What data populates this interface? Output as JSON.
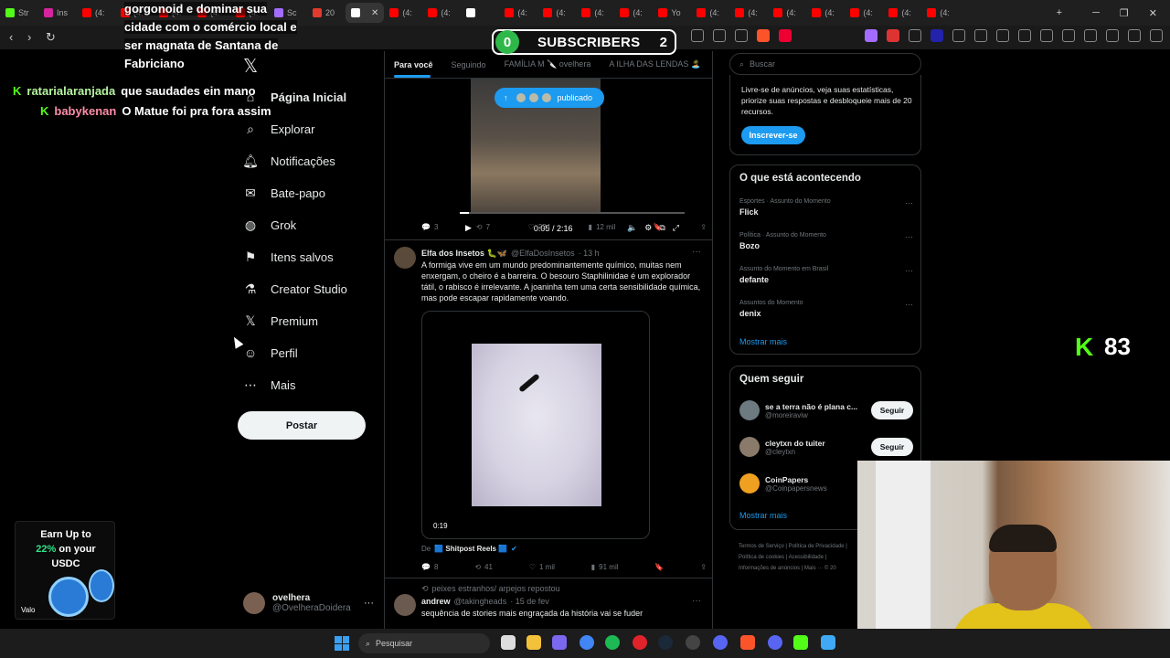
{
  "browser": {
    "tabs": [
      {
        "label": "Str",
        "color": "#53fc18"
      },
      {
        "label": "Ins",
        "color": "#d6249f"
      },
      {
        "label": "(4:",
        "color": "#ff0000"
      },
      {
        "label": "(4:",
        "color": "#ff0000"
      },
      {
        "label": "(4:",
        "color": "#ff0000"
      },
      {
        "label": "(4:",
        "color": "#ff0000"
      },
      {
        "label": "(4:",
        "color": "#ff0000"
      },
      {
        "label": "Sc",
        "color": "#a36cff"
      },
      {
        "label": "20",
        "color": "#e03b2e"
      },
      {
        "label": "",
        "color": "#ffffff",
        "active": true
      },
      {
        "label": "(4:",
        "color": "#ff0000"
      },
      {
        "label": "(4:",
        "color": "#ff0000"
      },
      {
        "label": "",
        "color": "#ffffff"
      },
      {
        "label": "(4:",
        "color": "#ff0000"
      },
      {
        "label": "(4:",
        "color": "#ff0000"
      },
      {
        "label": "(4:",
        "color": "#ff0000"
      },
      {
        "label": "(4:",
        "color": "#ff0000"
      },
      {
        "label": "Yo",
        "color": "#ff0000"
      },
      {
        "label": "(4:",
        "color": "#ff0000"
      },
      {
        "label": "(4:",
        "color": "#ff0000"
      },
      {
        "label": "(4:",
        "color": "#ff0000"
      },
      {
        "label": "(4:",
        "color": "#ff0000"
      },
      {
        "label": "(4:",
        "color": "#ff0000"
      },
      {
        "label": "(4:",
        "color": "#ff0000"
      },
      {
        "label": "(4:",
        "color": "#ff0000"
      }
    ]
  },
  "overlay": {
    "subscribers_left": "0",
    "subscribers_label": "SUBSCRIBERS",
    "subscribers_right": "2",
    "chat_top": "gorgonoid e dominar sua cidade com o comércio local e ser magnata de Santana de Fabriciano",
    "chat": [
      {
        "user": "ratarialaranjada",
        "msg": "que saudades ein mano"
      },
      {
        "user": "babykenan",
        "msg": "O Matue foi pra fora assim"
      }
    ],
    "kick_score": "83",
    "ad": {
      "line1": "Earn Up to",
      "pct": "22%",
      "line2": " on your",
      "line3": "USDC",
      "brand": "Valo"
    }
  },
  "sidebar": {
    "items": [
      {
        "label": "Página Inicial",
        "icon": "home-icon"
      },
      {
        "label": "Explorar",
        "icon": "search-icon"
      },
      {
        "label": "Notificações",
        "icon": "bell-icon"
      },
      {
        "label": "Bate-papo",
        "icon": "mail-icon"
      },
      {
        "label": "Grok",
        "icon": "grok-icon"
      },
      {
        "label": "Itens salvos",
        "icon": "bookmark-icon"
      },
      {
        "label": "Creator Studio",
        "icon": "flask-icon"
      },
      {
        "label": "Premium",
        "icon": "x-icon"
      },
      {
        "label": "Perfil",
        "icon": "person-icon"
      },
      {
        "label": "Mais",
        "icon": "more-icon"
      }
    ],
    "post_button": "Postar",
    "account": {
      "name": "ovelhera",
      "handle": "@OvelheraDoidera"
    }
  },
  "timeline": {
    "tabs": [
      "Para você",
      "Seguindo",
      "FAMÍLIA M 🔪 ovelhera",
      "A ILHA DAS LENDAS 🏝️"
    ],
    "pill": "publicado",
    "video1": {
      "time": "0:05 / 2:16",
      "progress": 0.04
    },
    "actions1": {
      "replies": "3",
      "reposts": "7",
      "likes": "224",
      "views": "12 mil"
    },
    "tweet2": {
      "name": "Elfa dos Insetos 🐛🦋",
      "handle": "@ElfaDosInsetos",
      "time": "· 13 h",
      "text": "A formiga vive em um mundo predominantemente químico, muitas nem enxergam, o cheiro é a barreira. O besouro Staphilinidae é um explorador tátil, o rabisco é irrelevante. A joaninha tem uma certa sensibilidade química, mas pode escapar rapidamente voando.",
      "video_duration": "0:19",
      "via_prefix": "De",
      "via_source": "🟦 Shitpost Reels 🟦",
      "replies": "8",
      "reposts": "41",
      "likes": "1 mil",
      "views": "91 mil"
    },
    "tweet3": {
      "repost_note": "peixes estranhos/ arpejos repostou",
      "name": "andrew",
      "handle": "@takingheads",
      "time": "· 15 de fev",
      "text": "sequência de stories mais engraçada da história vai se fuder"
    }
  },
  "right": {
    "search_placeholder": "Buscar",
    "premium_text": "Livre-se de anúncios, veja suas estatísticas, priorize suas respostas e desbloqueie mais de 20 recursos.",
    "premium_button": "Inscrever-se",
    "trends_title": "O que está acontecendo",
    "trends": [
      {
        "category": "Esportes · Assunto do Momento",
        "title": "Flick"
      },
      {
        "category": "Política · Assunto do Momento",
        "title": "Bozo"
      },
      {
        "category": "Assunto do Momento em Brasil",
        "title": "defante"
      },
      {
        "category": "Assuntos do Momento",
        "title": "denix"
      }
    ],
    "show_more": "Mostrar mais",
    "follow_title": "Quem seguir",
    "follow": [
      {
        "name": "se a terra não é plana c...",
        "handle": "@moreiraviw",
        "button": "Seguir",
        "color": "#6d7a80"
      },
      {
        "name": "cleytxn do tuiter",
        "handle": "@cleytxn",
        "button": "Seguir",
        "color": "#8a7a6a"
      },
      {
        "name": "CoinPapers",
        "handle": "@Coinpapersnews",
        "button": "",
        "color": "#f0a020"
      }
    ],
    "show_more_2": "Mostrar mais",
    "footer": "Termos de Serviço | Política de Privacidade | Política de cookies | Acessibilidade | Informações de anúncios | Mais ··· © 20"
  },
  "taskbar": {
    "search_placeholder": "Pesquisar"
  }
}
